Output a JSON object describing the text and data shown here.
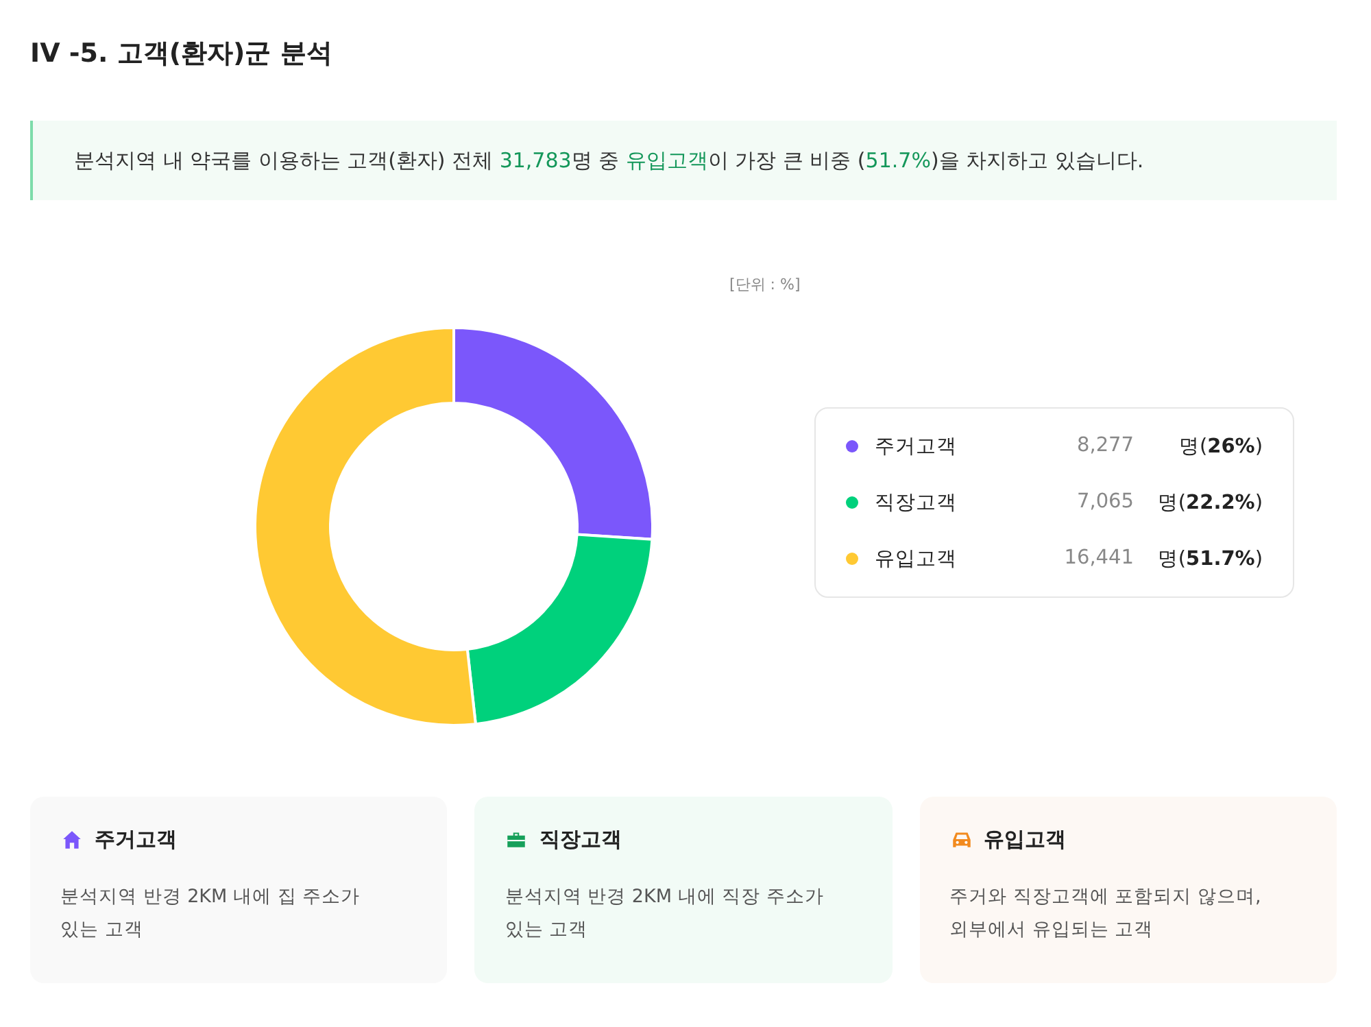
{
  "title": "IV -5. 고객(환자)군 분석",
  "summary": [
    {
      "text": "분석지역 내 약국를 이용하는 고객(환자) 전체 ",
      "highlight": false
    },
    {
      "text": "31,783",
      "highlight": true
    },
    {
      "text": "명 중 ",
      "highlight": false
    },
    {
      "text": "유입고객",
      "highlight": true
    },
    {
      "text": "이 가장 큰 비중 (",
      "highlight": false
    },
    {
      "text": "51.7%",
      "highlight": true
    },
    {
      "text": ")을 차지하고 있습니다.",
      "highlight": false
    }
  ],
  "unit_label": "[단위 : %]",
  "chart_data": {
    "type": "donut",
    "values": [
      26,
      22.2,
      51.7
    ]
  },
  "legend": [
    {
      "label": "주거고객",
      "count": "8,277",
      "share": "명(**26%**)",
      "color": "#7b57fb"
    },
    {
      "label": "직장고객",
      "count": "7,065",
      "share": "명(**22.2%**)",
      "color": "#00d17c"
    },
    {
      "label": "유입고객",
      "count": "16,441",
      "share": "명(**51.7%**)",
      "color": "#ffc933"
    }
  ],
  "cards": [
    {
      "kind": "home",
      "title": "주거고객",
      "description": "분석지역 반경 2KM 내에 집 주소가\n있는 고객"
    },
    {
      "kind": "work",
      "title": "직장고객",
      "description": "분석지역 반경 2KM 내에 직장 주소가\n있는 고객"
    },
    {
      "kind": "car",
      "title": "유입고객",
      "description": "주거와 직장고객에 포함되지 않으며,\n외부에서 유입되는 고객"
    }
  ]
}
